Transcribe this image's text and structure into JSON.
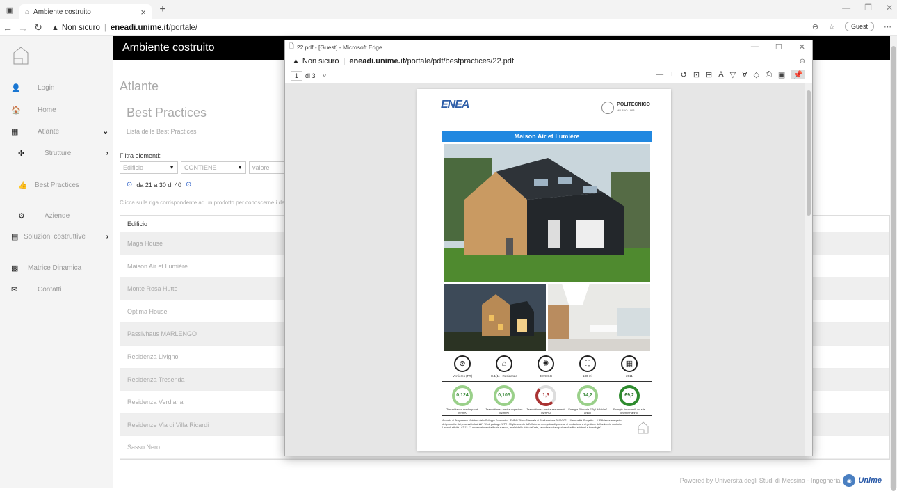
{
  "browser": {
    "tab_title": "Ambiente costruito",
    "url_warning": "Non sicuro",
    "url_host": "eneadi.unime.it",
    "url_path": "/portale/",
    "guest_label": "Guest"
  },
  "site": {
    "title": "Ambiente costruito"
  },
  "sidebar": {
    "items": [
      {
        "label": "Login",
        "icon": "user-icon",
        "has_arrow": false
      },
      {
        "label": "Home",
        "icon": "home-icon",
        "has_arrow": false
      },
      {
        "label": "Atlante",
        "icon": "table-icon",
        "has_arrow": true,
        "arrow": "down"
      },
      {
        "label": "Strutture",
        "icon": "cubes-icon",
        "has_arrow": true,
        "arrow": "right"
      },
      {
        "label": "Best Practices",
        "icon": "thumbs-up-icon",
        "has_arrow": false
      },
      {
        "label": "Aziende",
        "icon": "gears-icon",
        "has_arrow": false
      },
      {
        "label": "Soluzioni costruttive",
        "icon": "document-icon",
        "has_arrow": true,
        "arrow": "right"
      },
      {
        "label": "Matrice Dinamica",
        "icon": "calculator-icon",
        "has_arrow": false
      },
      {
        "label": "Contatti",
        "icon": "envelope-icon",
        "has_arrow": false
      }
    ]
  },
  "main": {
    "section": "Atlante",
    "title": "Best Practices",
    "subtitle": "Lista delle Best Practices",
    "filter_label": "Filtra elementi:",
    "filter_field": "Edificio",
    "filter_operator": "CONTIENE",
    "filter_value_placeholder": "valore",
    "pager_text": "da 21 a 30 di 40",
    "hint": "Clicca sulla riga corrispondente ad un prodotto per conoscerne i dettagli",
    "table_header": "Edificio",
    "rows": [
      "Maga House",
      "Maison Air et Lumière",
      "Monte Rosa Hutte",
      "Optima House",
      "Passivhaus MARLENGO",
      "Residenza Livigno",
      "Residenza Tresenda",
      "Residenza Verdiana",
      "Residenze Via di Villa Ricardi",
      "Sasso Nero"
    ],
    "footer_text": "Powered by Università degli Studi di Messina - Ingegneria",
    "footer_brand": "Unime"
  },
  "pdf_window": {
    "title": "22.pdf - [Guest] - Microsoft Edge",
    "url_warning": "Non sicuro",
    "url_host": "eneadi.unime.it",
    "url_path": "/portale/pdf/bestpractices/22.pdf",
    "page_current": "1",
    "page_total": "di 3",
    "document": {
      "logo_left": "ENEA",
      "logo_right": "POLITECNICO",
      "logo_right_sub": "MILANO 1863",
      "heading": "Maison Air et Lumière",
      "indicators": [
        {
          "icon": "location-icon",
          "symbol": "⊛",
          "caption": "Verrières (FR)"
        },
        {
          "icon": "house-icon",
          "symbol": "⌂",
          "caption": "E.1(1) - Residenze"
        },
        {
          "icon": "climate-icon",
          "symbol": "✺",
          "caption": "3079 GG"
        },
        {
          "icon": "area-icon",
          "symbol": "⛶",
          "caption": "130 m²"
        },
        {
          "icon": "calendar-icon",
          "symbol": "▦",
          "caption": "2011"
        }
      ],
      "gauges": [
        {
          "value": "0,124",
          "caption": "Trasmittanza media pareti [W/m²K]",
          "style": "light"
        },
        {
          "value": "0,105",
          "caption": "Trasmittanza media coperture [W/m²K]",
          "style": "light"
        },
        {
          "value": "1,3",
          "caption": "Trasmittanza media serramenti [W/m²K]",
          "style": "red"
        },
        {
          "value": "14,2",
          "caption": "Energia Primaria EPgl [kWh/m² anno]",
          "style": "light"
        },
        {
          "value": "69,2",
          "caption": "Energie rinnovabili on-site [kWh/m² anno]",
          "style": "dark"
        }
      ],
      "footnote": "Accordo di Programma Ministero dello Sviluppo Economico - ENEA / Piano Triennale di Realizzazione 2019/2021 - II annualità. Progetto: 1.5 \"Efficienza energetica dei prodotti e dei processi industriali\". Work package: WP2 - Miglioramento dell'efficienza energetica di processi di produzione e di gestione dell'ambiente costruito. Linea di attività LA2.12 - \"La costruzione stratificata a secco, analisi dello stato dell'arte, raccolta e catalogazione di edifici esistenti e tecnologie\""
    }
  }
}
